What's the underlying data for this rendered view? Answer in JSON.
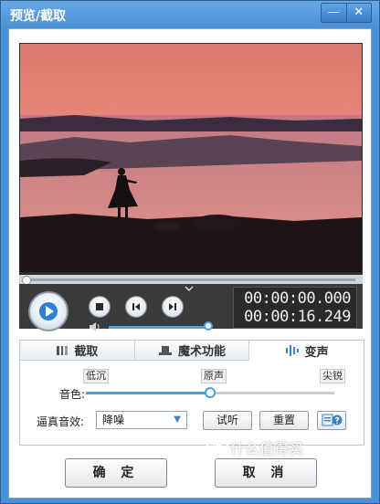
{
  "window": {
    "title": "预览/截取",
    "minimize_glyph": "—",
    "close_glyph": "✕"
  },
  "player": {
    "play_icon": "play-icon",
    "progress_fraction": 0.0,
    "volume_fraction": 1.0,
    "time_current": "00:00:00.000",
    "time_total": "00:00:16.249"
  },
  "tabs": [
    {
      "label": "截取",
      "icon": "scissors-icon",
      "active": false
    },
    {
      "label": "魔术功能",
      "icon": "magic-hat-icon",
      "active": false
    },
    {
      "label": "变声",
      "icon": "waveform-icon",
      "active": true
    }
  ],
  "voice": {
    "scale_low": "低沉",
    "scale_mid": "原声",
    "scale_high": "尖锐",
    "timbre_label": "音色:",
    "timbre_fraction": 0.5,
    "effect_label": "逼真音效:",
    "effect_value": "降噪",
    "listen_label": "试听",
    "reset_label": "重置"
  },
  "footer": {
    "ok_label": "确 定",
    "cancel_label": "取 消"
  },
  "watermark": {
    "badge": "值",
    "text": "什么值得买"
  },
  "colors": {
    "accent": "#4b9fe3",
    "titlebar": "#4a8fd3"
  }
}
